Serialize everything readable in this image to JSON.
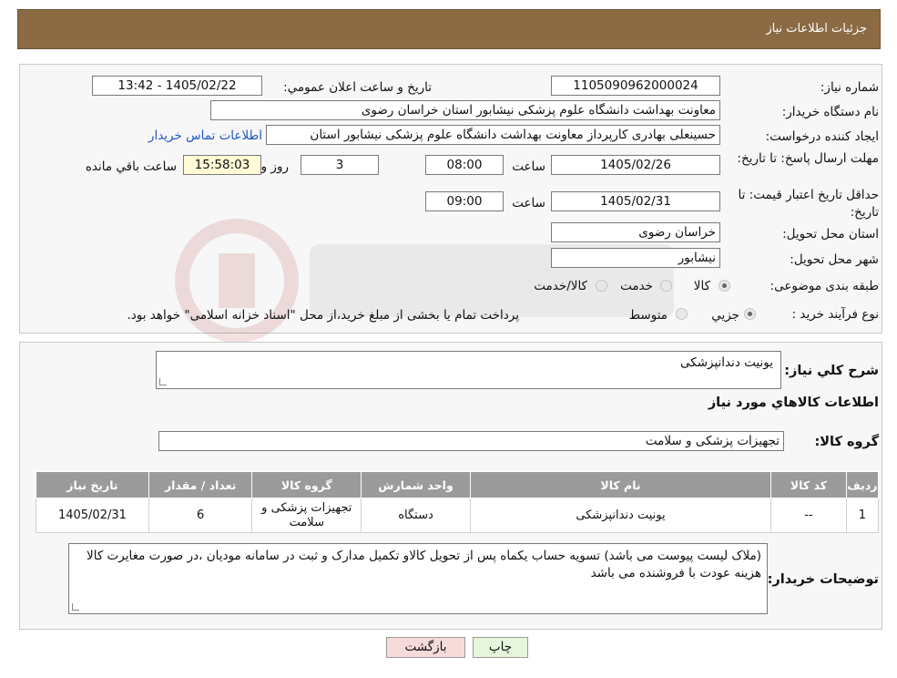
{
  "header": {
    "title": "جزئیات اطلاعات نیاز"
  },
  "form": {
    "need_number_label": "شماره نیاز:",
    "need_number": "1105090962000024",
    "announce_label": "تاریخ و ساعت اعلان عمومي:",
    "announce_value": "1405/02/22 - 13:42",
    "buyer_org_label": "نام دستگاه خريدار:",
    "buyer_org": "معاونت بهداشت دانشگاه علوم پزشکی نیشابور استان خراسان رضوی",
    "requester_label": "ايجاد کننده درخواست:",
    "requester": "حسینعلی بهادری کارپرداز معاونت بهداشت دانشگاه علوم پزشکی نیشابور استان",
    "contact_link": "اطلاعات تماس خريدار",
    "deadline_label": "مهلت ارسال پاسخ: تا تاریخ:",
    "deadline_date": "1405/02/26",
    "time_label": "ساعت",
    "deadline_time": "08:00",
    "days_value": "3",
    "days_label": "روز و",
    "remaining_time": "15:58:03",
    "remaining_label": "ساعت باقي مانده",
    "validity_label": "حداقل تاریخ اعتبار قیمت: تا تاریخ:",
    "validity_date": "1405/02/31",
    "validity_time": "09:00",
    "province_label": "استان محل تحويل:",
    "province": "خراسان رضوی",
    "city_label": "شهر محل تحويل:",
    "city": "نیشابور",
    "category_label": "طبقه بندی موضوعی:",
    "category_options": [
      "کالا",
      "خدمت",
      "کالا/خدمت"
    ],
    "category_selected": 0,
    "process_label": "نوع فرآيند خريد :",
    "process_options": [
      "جزيي",
      "متوسط"
    ],
    "process_selected": 0,
    "process_note": "پرداخت تمام يا بخشی از مبلغ خريد،از محل \"اسناد خزانه اسلامی\" خواهد بود."
  },
  "details": {
    "general_desc_label": "شرح کلي نياز:",
    "general_desc": "یونیت دندانپزشکی",
    "goods_info_title": "اطلاعات کالاهاي مورد نياز",
    "goods_group_label": "گروه کالا:",
    "goods_group": "تجهیزات پزشکی و سلامت",
    "table": {
      "headers": [
        "رديف",
        "کد کالا",
        "نام کالا",
        "واحد شمارش",
        "گروه کالا",
        "تعداد / مقدار",
        "تاريخ نياز"
      ],
      "rows": [
        [
          "1",
          "--",
          "یونیت دندانپزشکی",
          "دستگاه",
          "تجهیزات پزشکی و سلامت",
          "6",
          "1405/02/31"
        ]
      ]
    },
    "buyer_notes_label": "توضيحات خريدار:",
    "buyer_notes": "(ملاک لیست پیوست می باشد) تسویه حساب یکماه  پس از تحویل کالاو تکمیل مدارک و ثبت در سامانه مودیان ،در صورت مغایرت کالا هزینه عودت با فروشنده می باشد"
  },
  "buttons": {
    "print": "چاپ",
    "back": "بازگشت"
  },
  "colors": {
    "header": "#8b6a44",
    "back_button": "#f7dada",
    "print_button": "#e6f6dc",
    "link": "#1f57c8"
  }
}
